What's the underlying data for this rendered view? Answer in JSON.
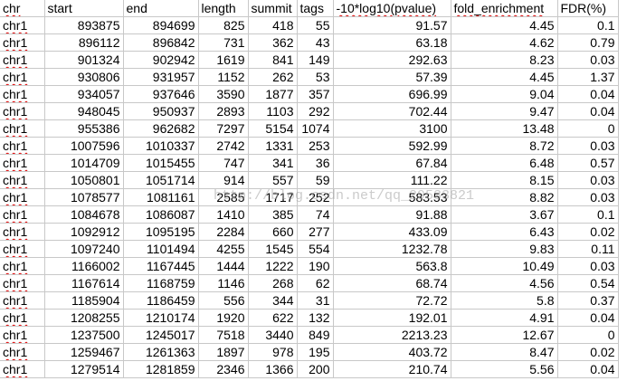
{
  "columns": [
    "chr",
    "start",
    "end",
    "length",
    "summit",
    "tags",
    "-10*log10(pvalue)",
    "fold_enrichment",
    "FDR(%)"
  ],
  "rows": [
    [
      "chr1",
      "893875",
      "894699",
      "825",
      "418",
      "55",
      "91.57",
      "4.45",
      "0.1"
    ],
    [
      "chr1",
      "896112",
      "896842",
      "731",
      "362",
      "43",
      "63.18",
      "4.62",
      "0.79"
    ],
    [
      "chr1",
      "901324",
      "902942",
      "1619",
      "841",
      "149",
      "292.63",
      "8.23",
      "0.03"
    ],
    [
      "chr1",
      "930806",
      "931957",
      "1152",
      "262",
      "53",
      "57.39",
      "4.45",
      "1.37"
    ],
    [
      "chr1",
      "934057",
      "937646",
      "3590",
      "1877",
      "357",
      "696.99",
      "9.04",
      "0.04"
    ],
    [
      "chr1",
      "948045",
      "950937",
      "2893",
      "1103",
      "292",
      "702.44",
      "9.47",
      "0.04"
    ],
    [
      "chr1",
      "955386",
      "962682",
      "7297",
      "5154",
      "1074",
      "3100",
      "13.48",
      "0"
    ],
    [
      "chr1",
      "1007596",
      "1010337",
      "2742",
      "1331",
      "253",
      "592.99",
      "8.72",
      "0.03"
    ],
    [
      "chr1",
      "1014709",
      "1015455",
      "747",
      "341",
      "36",
      "67.84",
      "6.48",
      "0.57"
    ],
    [
      "chr1",
      "1050801",
      "1051714",
      "914",
      "557",
      "59",
      "111.22",
      "8.15",
      "0.03"
    ],
    [
      "chr1",
      "1078577",
      "1081161",
      "2585",
      "1717",
      "252",
      "583.53",
      "8.82",
      "0.03"
    ],
    [
      "chr1",
      "1084678",
      "1086087",
      "1410",
      "385",
      "74",
      "91.88",
      "3.67",
      "0.1"
    ],
    [
      "chr1",
      "1092912",
      "1095195",
      "2284",
      "660",
      "277",
      "433.09",
      "6.43",
      "0.02"
    ],
    [
      "chr1",
      "1097240",
      "1101494",
      "4255",
      "1545",
      "554",
      "1232.78",
      "9.83",
      "0.11"
    ],
    [
      "chr1",
      "1166002",
      "1167445",
      "1444",
      "1222",
      "190",
      "563.8",
      "10.49",
      "0.03"
    ],
    [
      "chr1",
      "1167614",
      "1168759",
      "1146",
      "268",
      "62",
      "68.74",
      "4.56",
      "0.54"
    ],
    [
      "chr1",
      "1185904",
      "1186459",
      "556",
      "344",
      "31",
      "72.72",
      "5.8",
      "0.37"
    ],
    [
      "chr1",
      "1208255",
      "1210174",
      "1920",
      "622",
      "132",
      "192.01",
      "4.91",
      "0.04"
    ],
    [
      "chr1",
      "1237500",
      "1245017",
      "7518",
      "3440",
      "849",
      "2213.23",
      "12.67",
      "0"
    ],
    [
      "chr1",
      "1259467",
      "1261363",
      "1897",
      "978",
      "195",
      "403.72",
      "8.47",
      "0.02"
    ],
    [
      "chr1",
      "1279514",
      "1281859",
      "2346",
      "1366",
      "200",
      "210.74",
      "5.56",
      "0.04"
    ]
  ],
  "watermark": "http://blog.csdn.net/qq_29533821"
}
